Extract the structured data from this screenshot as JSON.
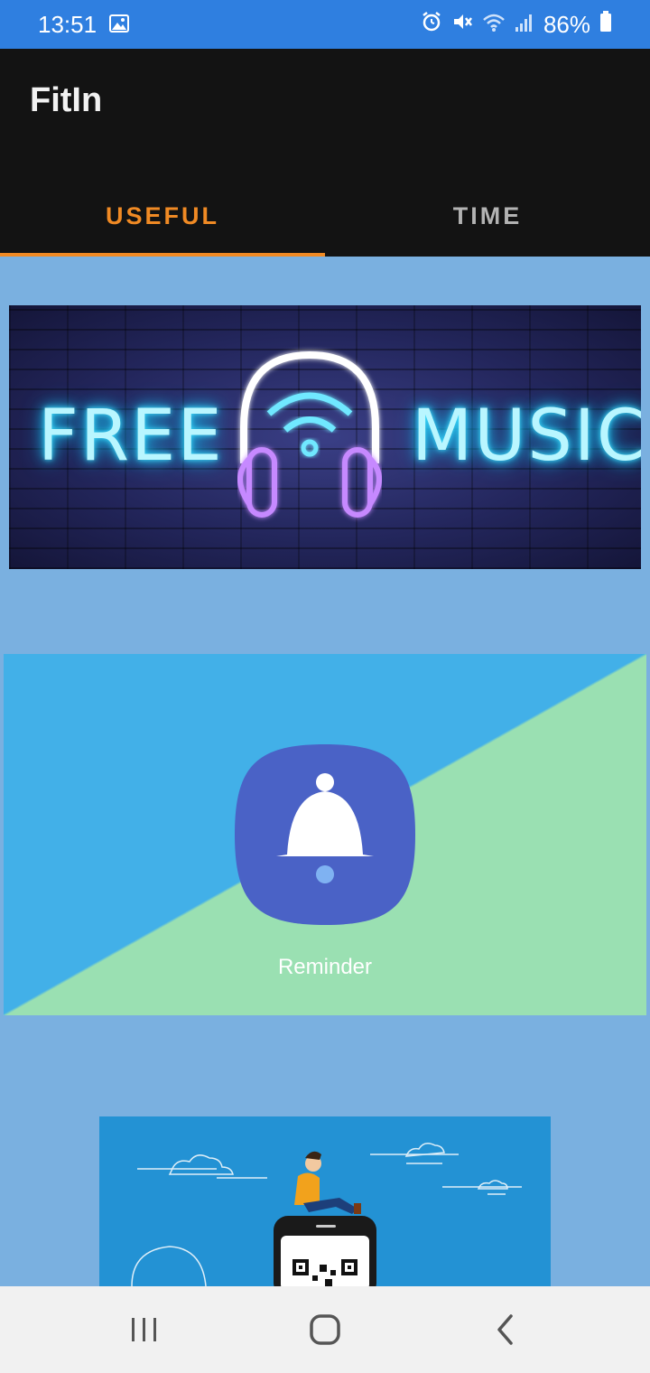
{
  "status_bar": {
    "time": "13:51",
    "battery": "86%",
    "icons": [
      "image-icon",
      "alarm-icon",
      "mute-icon",
      "wifi-icon",
      "signal-icon",
      "battery-icon"
    ]
  },
  "app": {
    "title": "FitIn"
  },
  "tabs": [
    {
      "label": "USEFUL",
      "active": true
    },
    {
      "label": "TIME",
      "active": false
    }
  ],
  "cards": {
    "music": {
      "word_left": "FREE",
      "word_right": "MUSIC"
    },
    "reminder": {
      "label": "Reminder"
    }
  },
  "nav": {
    "icons": [
      "recent-apps-icon",
      "home-icon",
      "back-icon"
    ]
  },
  "colors": {
    "accent": "#f08a24",
    "status_bar": "#2f7fe0",
    "app_bar": "#131313",
    "background": "#7ab0e0",
    "reminder_blue": "#42b0e8",
    "reminder_green": "#9ae0b2",
    "reminder_icon": "#4a62c6"
  }
}
